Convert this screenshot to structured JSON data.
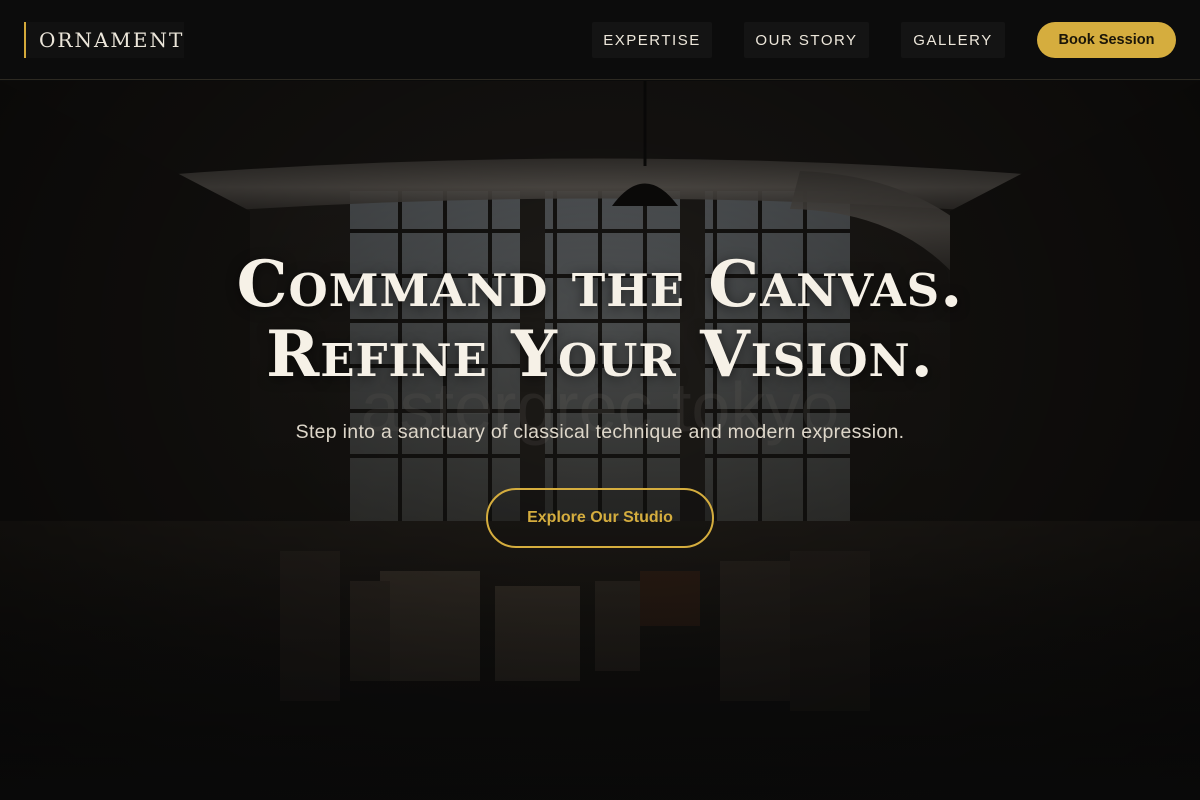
{
  "brand": {
    "name": "ORNAMENT",
    "accent": "#d5ad3e"
  },
  "nav": {
    "items": [
      {
        "label": "EXPERTISE"
      },
      {
        "label": "OUR STORY"
      },
      {
        "label": "GALLERY"
      }
    ],
    "book_label": "Book Session"
  },
  "hero": {
    "headline_line1": "Command the Canvas.",
    "headline_line2": "Refine Your Vision.",
    "subheadline": "Step into a sanctuary of classical technique and modern expression.",
    "cta_label": "Explore Our Studio",
    "background_image": "dark-art-studio-warehouse"
  }
}
